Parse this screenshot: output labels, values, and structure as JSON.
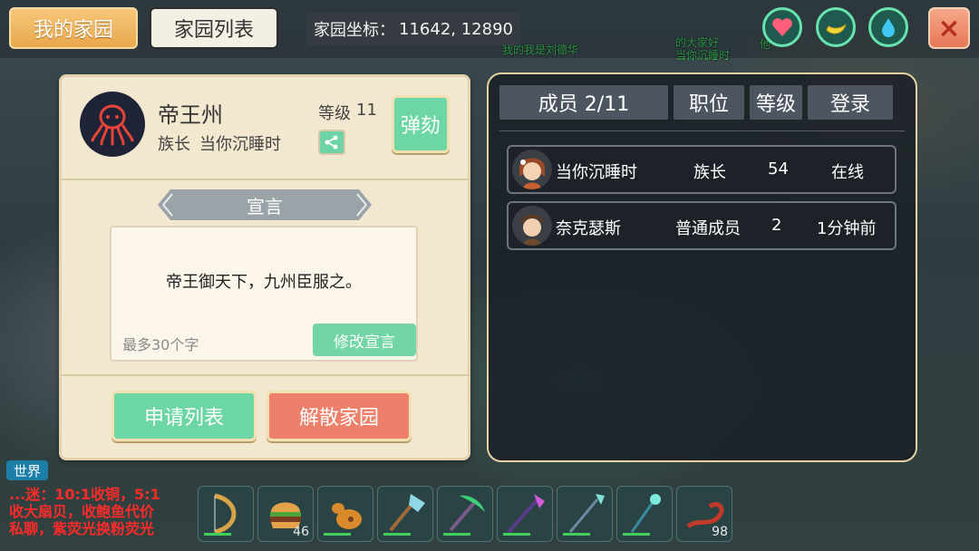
{
  "top": {
    "tab_home": "我的家园",
    "tab_list": "家园列表",
    "coords_label": "家园坐标：",
    "coords_value": "11642, 12890",
    "floating_names": [
      "我的我是刘德华",
      "的大家好",
      "当你沉睡时",
      "他"
    ],
    "icons": [
      "heart-icon",
      "banana-icon",
      "water-drop-icon"
    ],
    "close_icon": "×"
  },
  "clan": {
    "name": "帝王州",
    "role_label": "族长",
    "leader": "当你沉睡时",
    "level_label": "等级",
    "level": "11",
    "impeach_label": "弹劾",
    "declaration_title": "宣言",
    "declaration": "帝王御天下，九州臣服之。",
    "declaration_hint": "最多30个字",
    "edit_label": "修改宣言",
    "apply_list_label": "申请列表",
    "disband_label": "解散家园"
  },
  "members": {
    "tab_members": "成员 2/11",
    "tab_position": "职位",
    "tab_level": "等级",
    "tab_login": "登录",
    "rows": [
      {
        "name": "当你沉睡时",
        "position": "族长",
        "level": "54",
        "login": "在线"
      },
      {
        "name": "奈克瑟斯",
        "position": "普通成员",
        "level": "2",
        "login": "1分钟前"
      }
    ]
  },
  "chat": {
    "channel": "世界",
    "lines": [
      "...迷：10:1收铜，5:1",
      "收大扇贝，收鲍鱼代价",
      "私聊，紫荧光换粉荧光"
    ]
  },
  "hotbar": {
    "counts": [
      "46",
      "98"
    ]
  },
  "colors": {
    "accent_green": "#6cd7a5",
    "danger_red": "#ec806b",
    "home_tab": "#e9a84c"
  }
}
